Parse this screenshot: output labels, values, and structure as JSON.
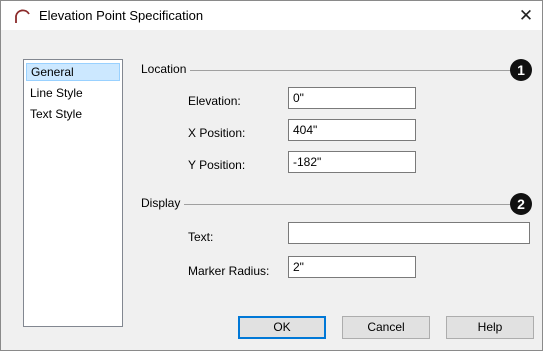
{
  "window": {
    "title": "Elevation Point Specification",
    "close_glyph": "✕",
    "app_icon": "arc-icon"
  },
  "nav": {
    "items": [
      {
        "label": "General",
        "selected": true
      },
      {
        "label": "Line Style",
        "selected": false
      },
      {
        "label": "Text Style",
        "selected": false
      }
    ]
  },
  "location": {
    "group_label": "Location",
    "badge": "1",
    "elevation_label": "Elevation:",
    "elevation_value": "0\"",
    "x_label": "X Position:",
    "x_value": "404\"",
    "y_label": "Y Position:",
    "y_value": "-182\""
  },
  "display": {
    "group_label": "Display",
    "badge": "2",
    "text_label": "Text:",
    "text_value": "",
    "radius_label": "Marker Radius:",
    "radius_value": "2\""
  },
  "buttons": {
    "ok": "OK",
    "cancel": "Cancel",
    "help": "Help"
  },
  "colors": {
    "selection_bg": "#cce8ff",
    "default_button_border": "#0078d7",
    "badge_bg": "#111111"
  }
}
